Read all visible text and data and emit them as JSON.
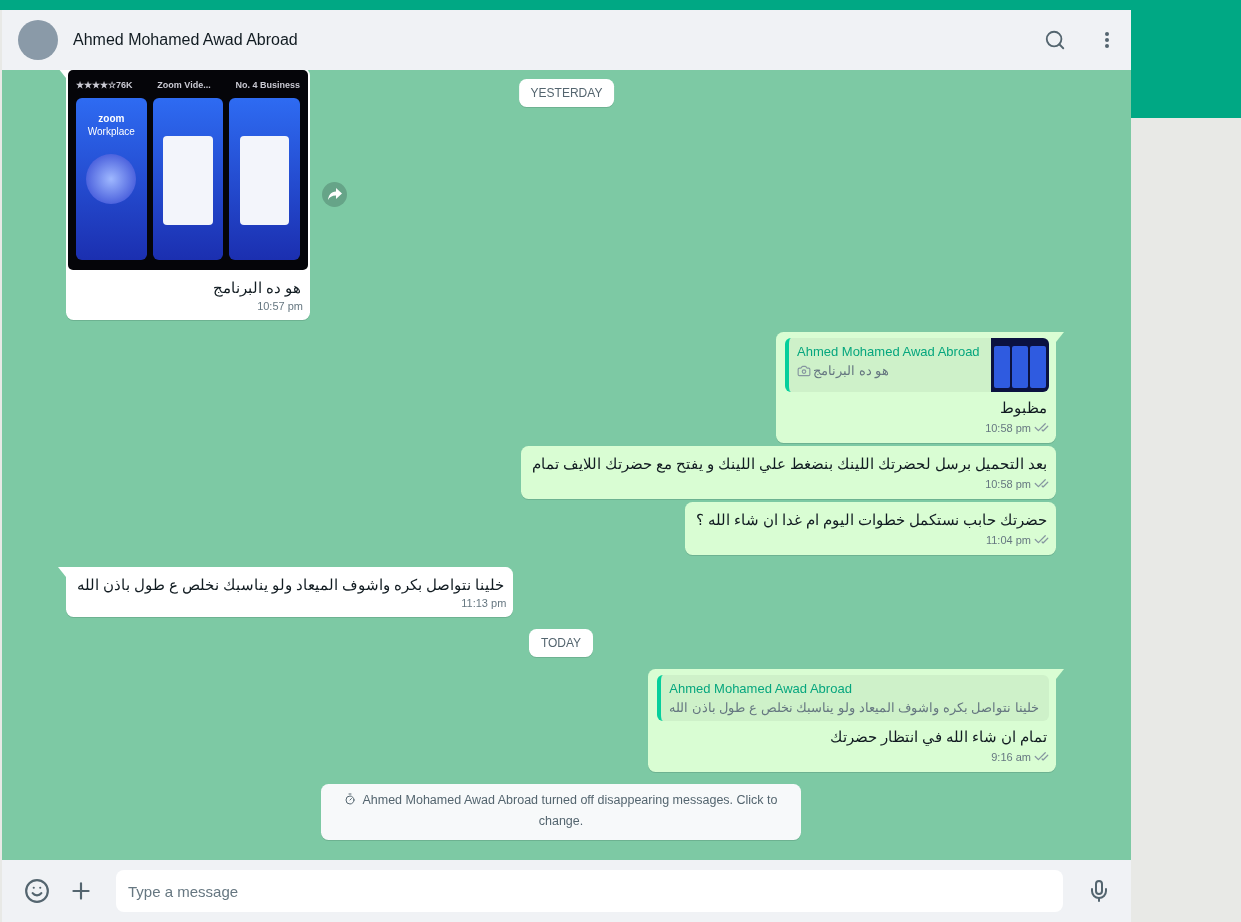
{
  "header": {
    "contact_name": "Ahmed Mohamed Awad Abroad"
  },
  "messages": [
    {
      "kind": "image",
      "outgoing": false,
      "image": {
        "rating": "★★★★☆76K",
        "app": "Zoom Vide...",
        "rank": "No. 4",
        "category": "Business",
        "brand": "zoom",
        "product": "Workplace"
      },
      "text": "هو ده البرنامج",
      "time": "10:57 pm",
      "forward": true
    },
    {
      "kind": "date",
      "text": "YESTERDAY"
    },
    {
      "kind": "text",
      "outgoing": true,
      "quote": {
        "author": "Ahmed Mohamed Awad Abroad",
        "text": "هو ده البرنامج",
        "has_photo": true
      },
      "text": "مظبوط",
      "time": "10:58 pm",
      "read": false,
      "tail": true
    },
    {
      "kind": "text",
      "outgoing": true,
      "text": "بعد التحميل برسل لحضرتك اللينك بنضغط علي اللينك و يفتح مع حضرتك اللايف تمام",
      "time": "10:58 pm",
      "read": false,
      "tail": false
    },
    {
      "kind": "text",
      "outgoing": true,
      "text": "حضرتك حابب نستكمل خطوات اليوم ام غدا ان شاء الله ؟",
      "time": "11:04 pm",
      "read": false,
      "tail": false
    },
    {
      "kind": "text",
      "outgoing": false,
      "text": "خلينا نتواصل بكره واشوف الميعاد ولو يناسبك نخلص ع طول باذن الله",
      "time": "11:13 pm",
      "tail": true
    },
    {
      "kind": "date",
      "text": "TODAY"
    },
    {
      "kind": "text",
      "outgoing": true,
      "quote": {
        "author": "Ahmed Mohamed Awad Abroad",
        "text": "خلينا نتواصل بكره واشوف الميعاد ولو يناسبك نخلص ع طول باذن الله",
        "has_photo": false
      },
      "text": "تمام ان شاء الله في انتظار حضرتك",
      "time": "9:16 am",
      "read": false,
      "tail": true
    },
    {
      "kind": "system",
      "text": "Ahmed Mohamed Awad Abroad turned off disappearing messages. Click to change."
    }
  ],
  "composer": {
    "placeholder": "Type a message"
  }
}
